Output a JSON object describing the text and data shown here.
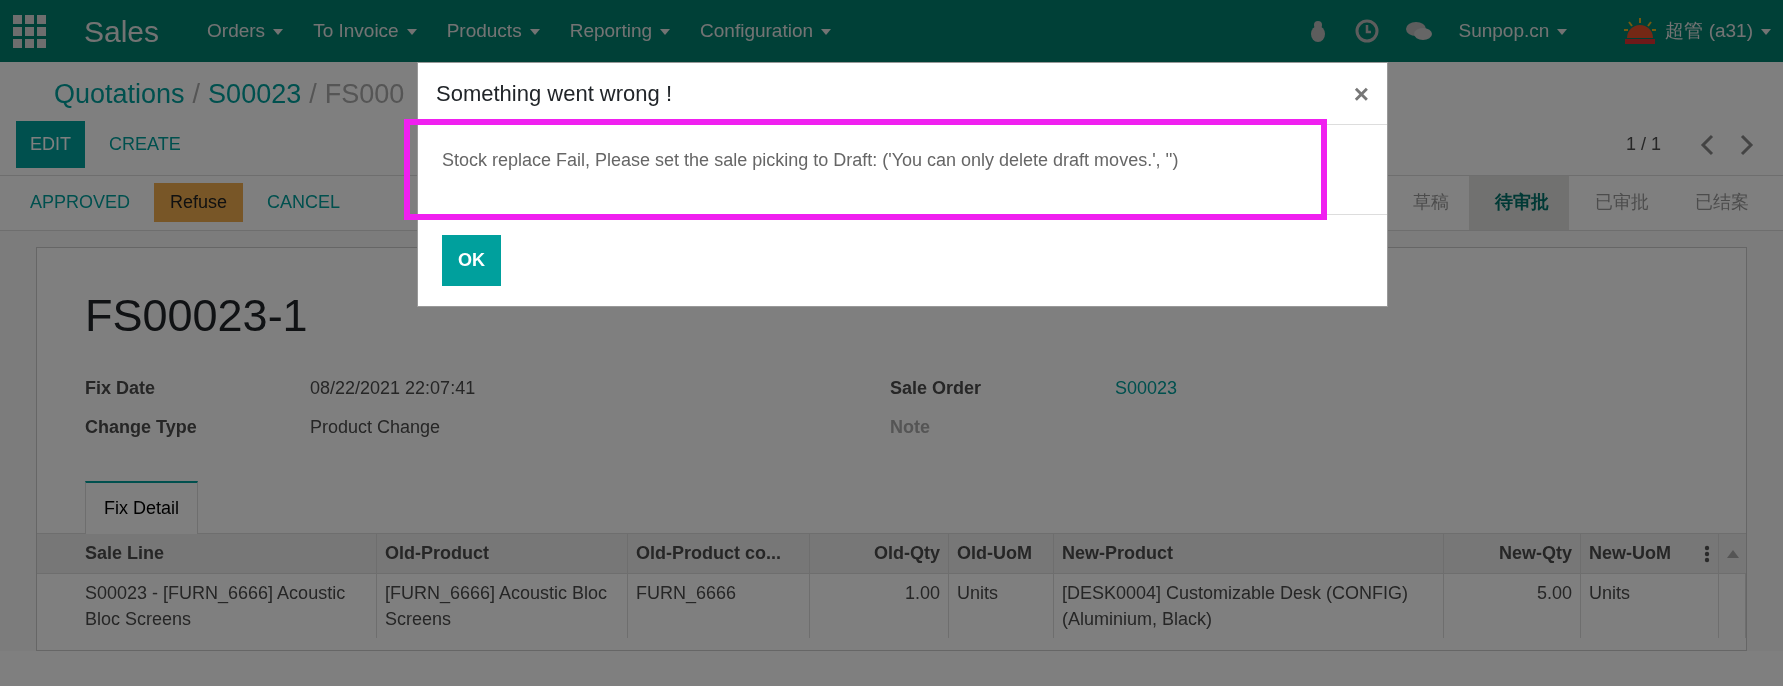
{
  "navbar": {
    "app_title": "Sales",
    "menus": [
      "Orders",
      "To Invoice",
      "Products",
      "Reporting",
      "Configuration"
    ],
    "company": "Sunpop.cn",
    "user": "超管 (a31)"
  },
  "breadcrumb": [
    {
      "label": "Quotations",
      "kind": "link"
    },
    {
      "label": "/",
      "kind": "separator"
    },
    {
      "label": "S00023",
      "kind": "link"
    },
    {
      "label": "/",
      "kind": "separator"
    },
    {
      "label": "FS000",
      "kind": "current"
    }
  ],
  "control_buttons": [
    {
      "label": "EDIT",
      "kind": "primary"
    },
    {
      "label": "CREATE",
      "kind": "secondary"
    }
  ],
  "pager": {
    "value": "1 / 1"
  },
  "header_buttons": [
    {
      "label": "APPROVED",
      "kind": "link"
    },
    {
      "label": "Refuse",
      "kind": "warning"
    },
    {
      "label": "CANCEL",
      "kind": "link"
    }
  ],
  "stages": [
    {
      "label": "草稿",
      "selected": false
    },
    {
      "label": "待审批",
      "selected": true
    },
    {
      "label": "已审批",
      "selected": false
    },
    {
      "label": "已结案",
      "selected": false
    }
  ],
  "record": {
    "title": "FS00023-1",
    "fields_left": [
      {
        "label": "Fix Date",
        "value": "08/22/2021 22:07:41",
        "kind": "text"
      },
      {
        "label": "Change Type",
        "value": "Product Change",
        "kind": "text"
      }
    ],
    "fields_right": [
      {
        "label": "Sale Order",
        "value": "S00023",
        "kind": "link"
      },
      {
        "label": "Note",
        "kind": "empty"
      }
    ]
  },
  "tabs": [
    {
      "label": "Fix Detail",
      "selected": true
    }
  ],
  "table": {
    "columns": [
      {
        "label": "Sale Line",
        "numeric": false
      },
      {
        "label": "Old-Product",
        "numeric": false
      },
      {
        "label": "Old-Product co...",
        "numeric": false
      },
      {
        "label": "Old-Qty",
        "numeric": true
      },
      {
        "label": "Old-UoM",
        "numeric": false
      },
      {
        "label": "New-Product",
        "numeric": false
      },
      {
        "label": "New-Qty",
        "numeric": true
      },
      {
        "label": "New-UoM",
        "numeric": false
      }
    ],
    "rows": [
      [
        "S00023 - [FURN_6666] Acoustic Bloc Screens",
        "[FURN_6666] Acoustic Bloc Screens",
        "FURN_6666",
        "1.00",
        "Units",
        "[DESK0004] Customizable Desk (CONFIG) (Aluminium, Black)",
        "5.00",
        "Units"
      ]
    ]
  },
  "dialog": {
    "title": "Something went wrong !",
    "close": "×",
    "message": "Stock replace Fail, Please set the sale picking to Draft: ('You can only delete draft moves.', '')",
    "highlighted": true,
    "button": "OK"
  }
}
